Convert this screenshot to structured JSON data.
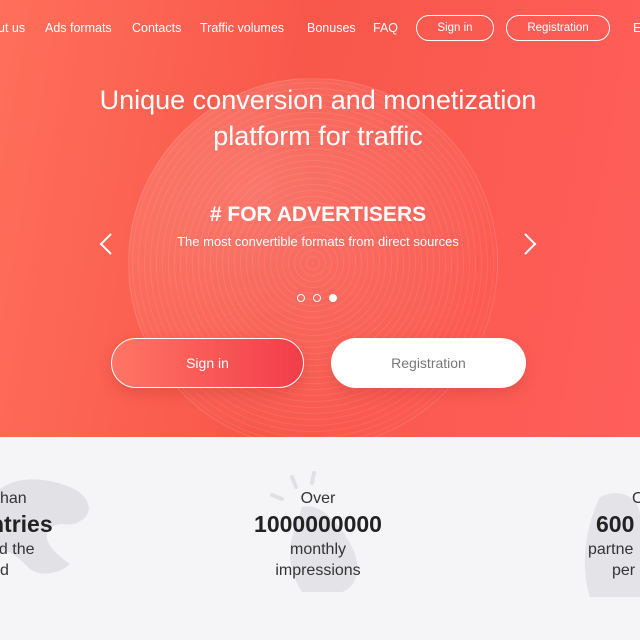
{
  "nav": {
    "links": [
      "ut us",
      "Ads formats",
      "Contacts",
      "Traffic volumes",
      "Bonuses",
      "FAQ"
    ],
    "signin": "Sign in",
    "registration": "Registration",
    "lang": "E"
  },
  "hero": {
    "headline_line1": "Unique conversion and monetization",
    "headline_line2": "platform for traffic",
    "slide_title": "# FOR ADVERTISERS",
    "slide_subtitle": "The most convertible formats from direct sources",
    "active_slide": 3,
    "slide_count": 3,
    "signin": "Sign in",
    "registration": "Registration"
  },
  "stats": [
    {
      "line1": "han",
      "big": "ntries",
      "line3": "nd the",
      "line4": "d"
    },
    {
      "line1": "Over",
      "big": "1000000000",
      "line3": "monthly",
      "line4": "impressions"
    },
    {
      "line1": "O",
      "big": "600",
      "line3": "partne",
      "line4": "per"
    }
  ],
  "colors": {
    "accent": "#f8574a",
    "white": "#ffffff"
  }
}
